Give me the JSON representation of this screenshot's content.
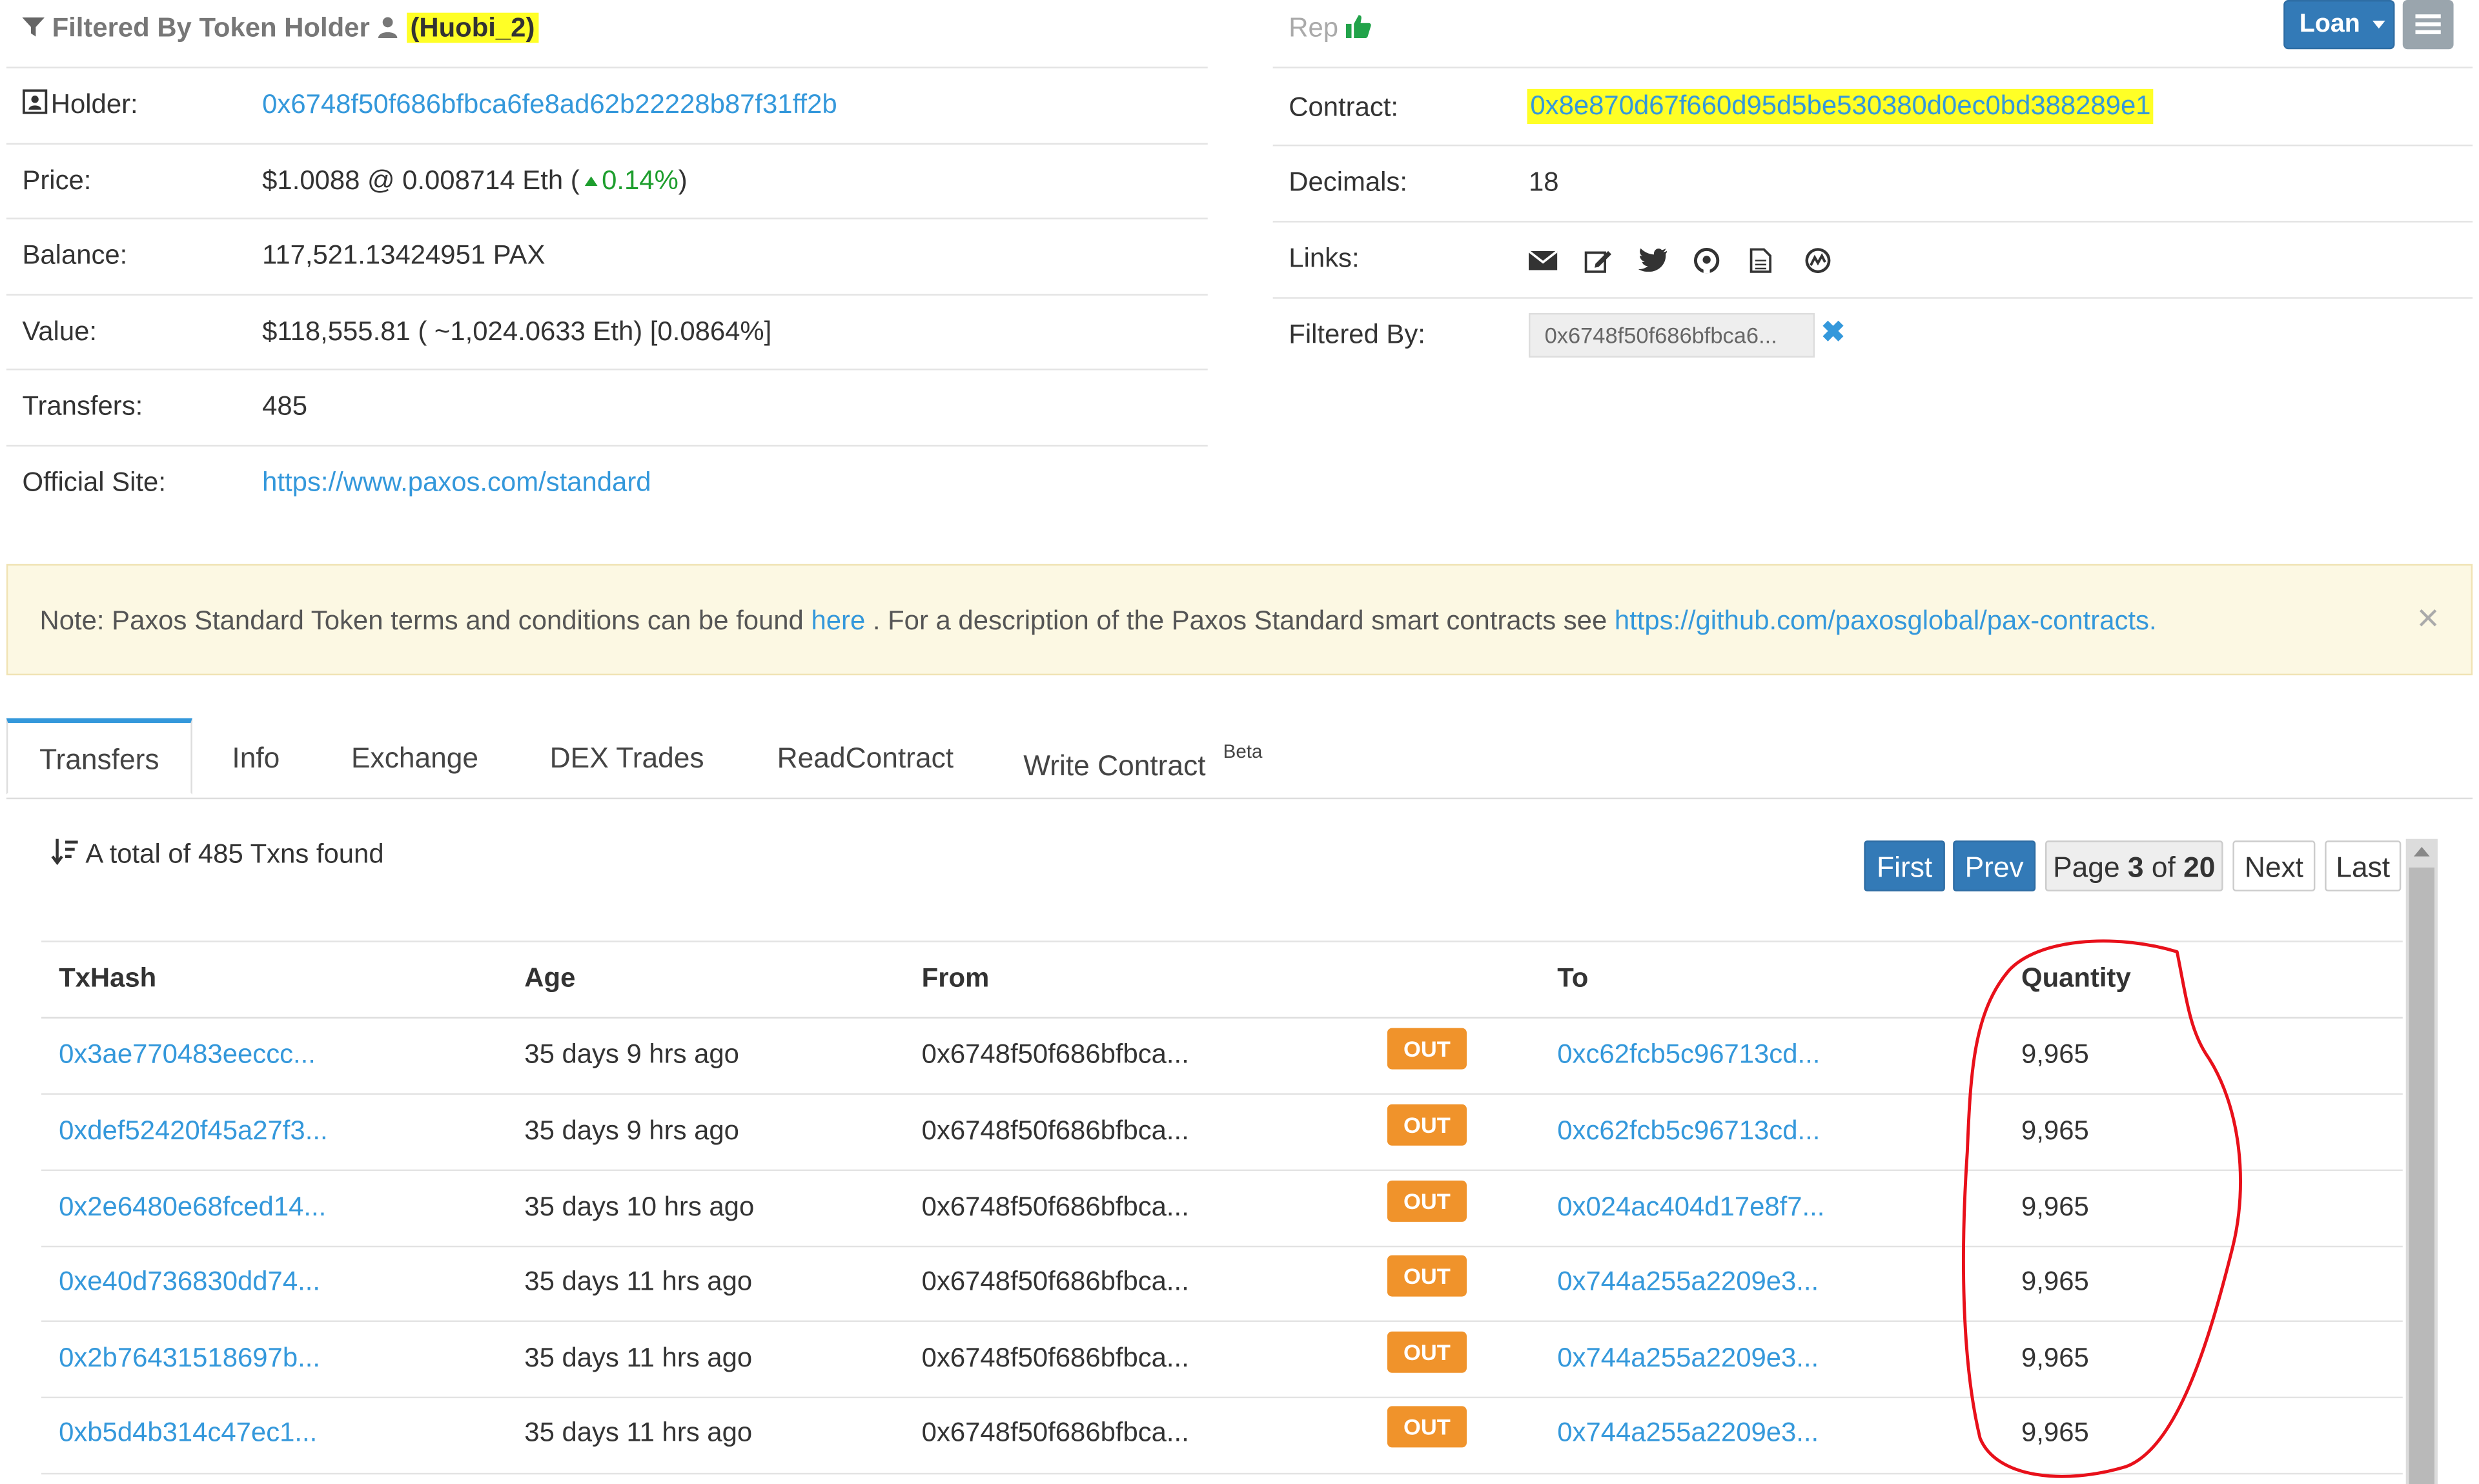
{
  "header": {
    "filtered_by_label": "Filtered By Token Holder",
    "holder_tag": "(Huobi_2)",
    "rep_label": "Rep",
    "loan_button": "Loan",
    "colors": {
      "highlight": "#ffff26",
      "link": "#3498db",
      "primary_button": "#337ab7",
      "out_badge": "#f0932b",
      "annotation_circle": "#e8101a"
    }
  },
  "overview": {
    "holder_label": "Holder:",
    "holder_value": "0x6748f50f686bfbca6fe8ad62b22228b87f31ff2b",
    "price_label": "Price:",
    "price_value": "$1.0088 @ 0.008714 Eth (",
    "price_change": "0.14%",
    "price_close": ")",
    "balance_label": "Balance:",
    "balance_value": "117,521.13424951 PAX",
    "value_label": "Value:",
    "value_value": "$118,555.81 ( ~1,024.0633 Eth) [0.0864%]",
    "transfers_label": "Transfers:",
    "transfers_value": "485",
    "site_label": "Official Site:",
    "site_value": "https://www.paxos.com/standard"
  },
  "contract": {
    "contract_label": "Contract:",
    "contract_value": "0x8e870d67f660d95d5be530380d0ec0bd388289e1",
    "decimals_label": "Decimals:",
    "decimals_value": "18",
    "links_label": "Links:",
    "filtered_by_label": "Filtered By:",
    "filtered_by_value": "0x6748f50f686bfbca6..."
  },
  "note": {
    "text_before": "Note: Paxos Standard Token terms and conditions can be found ",
    "here_link": "here",
    "text_middle": " . For a description of the Paxos Standard smart contracts see ",
    "github_link": "https://github.com/paxosglobal/pax-contracts",
    "text_after": ".",
    "close": "×"
  },
  "tabs": [
    {
      "label": "Transfers"
    },
    {
      "label": "Info"
    },
    {
      "label": "Exchange"
    },
    {
      "label": "DEX Trades"
    },
    {
      "label": "ReadContract"
    },
    {
      "label": "Write Contract"
    }
  ],
  "tabs_beta": "Beta",
  "transfers": {
    "summary": "A total of 485 Txns found",
    "pager": {
      "first": "First",
      "prev": "Prev",
      "page_prefix": "Page ",
      "page_current": "3",
      "page_mid": " of ",
      "page_total": "20",
      "next": "Next",
      "last": "Last"
    },
    "columns": [
      "TxHash",
      "Age",
      "From",
      "To",
      "Quantity"
    ],
    "rows": [
      {
        "hash": "0x3ae770483eeccc...",
        "age": "35 days 9 hrs ago",
        "from": "0x6748f50f686bfbca...",
        "dir": "OUT",
        "to": "0xc62fcb5c96713cd...",
        "qty": "9,965"
      },
      {
        "hash": "0xdef52420f45a27f3...",
        "age": "35 days 9 hrs ago",
        "from": "0x6748f50f686bfbca...",
        "dir": "OUT",
        "to": "0xc62fcb5c96713cd...",
        "qty": "9,965"
      },
      {
        "hash": "0x2e6480e68fced14...",
        "age": "35 days 10 hrs ago",
        "from": "0x6748f50f686bfbca...",
        "dir": "OUT",
        "to": "0x024ac404d17e8f7...",
        "qty": "9,965"
      },
      {
        "hash": "0xe40d736830dd74...",
        "age": "35 days 11 hrs ago",
        "from": "0x6748f50f686bfbca...",
        "dir": "OUT",
        "to": "0x744a255a2209e3...",
        "qty": "9,965"
      },
      {
        "hash": "0x2b76431518697b...",
        "age": "35 days 11 hrs ago",
        "from": "0x6748f50f686bfbca...",
        "dir": "OUT",
        "to": "0x744a255a2209e3...",
        "qty": "9,965"
      },
      {
        "hash": "0xb5d4b314c47ec1...",
        "age": "35 days 11 hrs ago",
        "from": "0x6748f50f686bfbca...",
        "dir": "OUT",
        "to": "0x744a255a2209e3...",
        "qty": "9,965"
      }
    ]
  }
}
